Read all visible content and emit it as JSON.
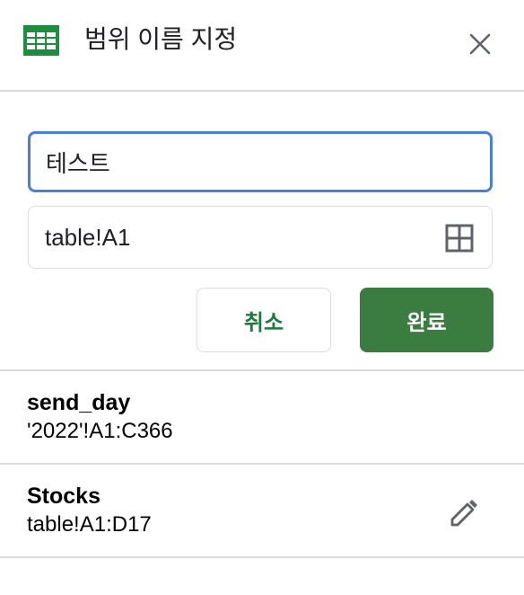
{
  "header": {
    "title": "범위 이름 지정",
    "app_icon": "sheets-icon",
    "close_icon": "close-icon"
  },
  "form": {
    "name_value": "테스트",
    "range_value": "table!A1",
    "range_icon": "grid-select-icon",
    "cancel_label": "취소",
    "done_label": "완료"
  },
  "named_ranges": [
    {
      "name": "send_day",
      "range": "'2022'!A1:C366"
    },
    {
      "name": "Stocks",
      "range": "table!A1:D17",
      "edit_icon": "pencil-icon"
    }
  ],
  "colors": {
    "accent_green": "#3b7d40",
    "focus_blue": "#4a7fd6",
    "icon_gray": "#5f6368",
    "sheets_green": "#1e8e3e"
  }
}
